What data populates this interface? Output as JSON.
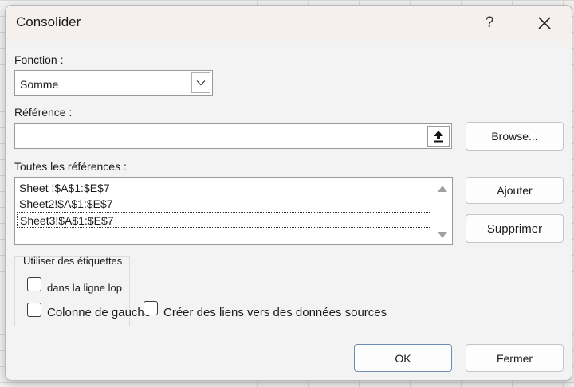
{
  "dialog": {
    "title": "Consolider",
    "help_glyph": "?",
    "close_icon": "close-icon"
  },
  "function_section": {
    "label": "Fonction :",
    "selected": "Somme",
    "dropdown_icon": "chevron-down-icon"
  },
  "reference_section": {
    "label": "Référence :",
    "value": "",
    "upload_icon": "upload-arrow-icon",
    "browse_label": "Browse..."
  },
  "all_references": {
    "label": "Toutes les références :",
    "items": [
      "Sheet   !$A$1:$E$7",
      "Sheet2!$A$1:$E$7",
      "Sheet3!$A$1:$E$7"
    ],
    "selected_index": 2
  },
  "buttons": {
    "add": "Ajouter",
    "remove": "Supprimer",
    "ok": "OK",
    "close": "Fermer"
  },
  "labels_group": {
    "title": "Utiliser des étiquettes",
    "top_row": "dans la ligne lop",
    "left_column": "Colonne de gauche",
    "links": "Créer des liens vers des données sources"
  },
  "colors": {
    "dialog_bg": "#f3f3f3",
    "titlebar_bg": "#f5efee",
    "primary_border": "#6b8db5"
  }
}
